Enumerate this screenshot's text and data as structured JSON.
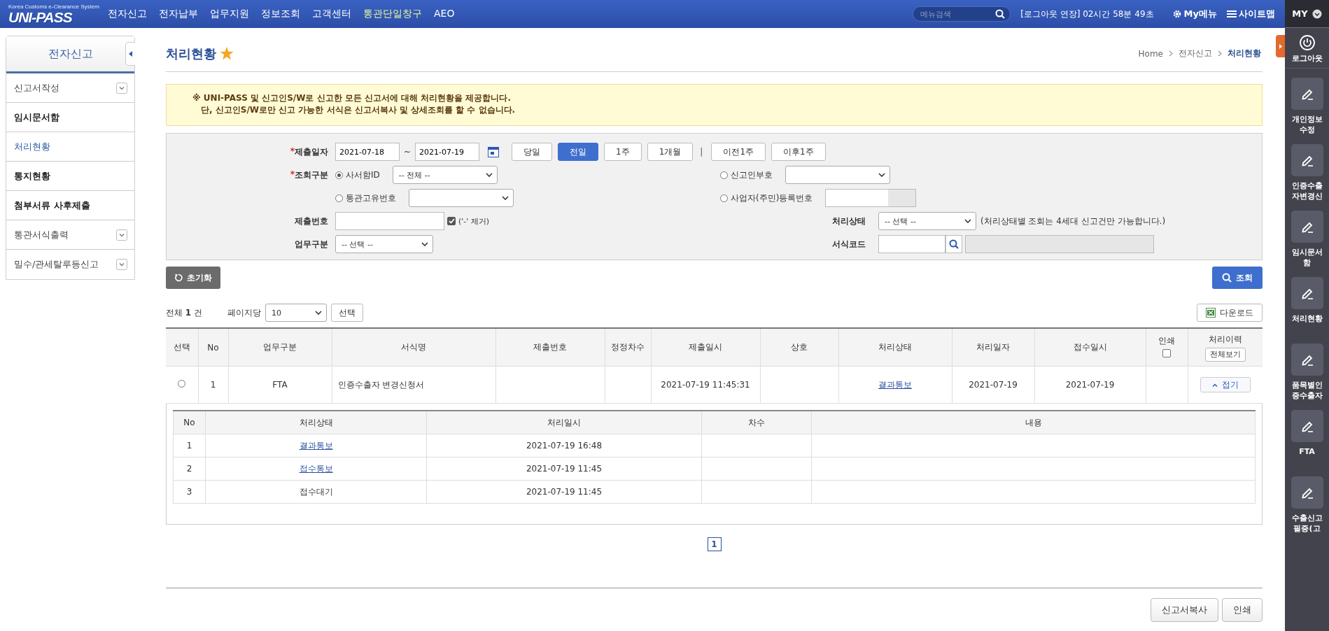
{
  "top_nav": {
    "logo": "UNI-PASS",
    "logo_tagline": "Korea Customs e-Clearance System",
    "menu": [
      {
        "label": "전자신고",
        "highlight": false
      },
      {
        "label": "전자납부",
        "highlight": false
      },
      {
        "label": "업무지원",
        "highlight": false
      },
      {
        "label": "정보조회",
        "highlight": false
      },
      {
        "label": "고객센터",
        "highlight": false
      },
      {
        "label": "통관단일창구",
        "highlight": true
      },
      {
        "label": "AEO",
        "highlight": false
      }
    ],
    "search": {
      "placeholder": "메뉴검색"
    },
    "session": "[로그아웃 연장] 02시간 58분 49초",
    "my_menu": "My메뉴",
    "sitemap": "사이트맵",
    "my": "MY"
  },
  "sidebar": {
    "title": "전자신고",
    "items": [
      {
        "label": "신고서작성",
        "kind": "folder",
        "expanded": false,
        "selected": false
      },
      {
        "label": "임시문서함",
        "kind": "link",
        "selected": false
      },
      {
        "label": "처리현황",
        "kind": "link",
        "selected": true
      },
      {
        "label": "통지현황",
        "kind": "link",
        "selected": false
      },
      {
        "label": "첨부서류 사후제출",
        "kind": "link",
        "selected": false
      },
      {
        "label": "통관서식출력",
        "kind": "folder",
        "expanded": false,
        "selected": false
      },
      {
        "label": "밀수/관세탈루등신고",
        "kind": "folder",
        "expanded": false,
        "selected": false
      }
    ]
  },
  "page": {
    "title": "처리현황",
    "favorite": true,
    "breadcrumb": [
      {
        "label": "Home",
        "current": false
      },
      {
        "label": "전자신고",
        "current": false
      },
      {
        "label": "처리현황",
        "current": true
      }
    ]
  },
  "notice": {
    "lines": [
      "※ UNI-PASS 및 신고인S/W로 신고한 모든 신고서에 대해 처리현황을 제공합니다.",
      "단, 신고인S/W로만 신고 가능한 서식은 신고서복사 및 상세조회를 할 수 없습니다."
    ]
  },
  "search_form": {
    "required_mark": "*",
    "submit_date": {
      "label": "제출일자",
      "required": true,
      "from": "2021-07-18",
      "separator": "~",
      "to": "2021-07-19"
    },
    "period_buttons": [
      {
        "label": "당일",
        "selected": false
      },
      {
        "label": "전일",
        "selected": true
      },
      {
        "label": "1주",
        "selected": false
      },
      {
        "label": "1개월",
        "selected": false
      }
    ],
    "group_divider": "|",
    "week_buttons": [
      {
        "label": "이전1주",
        "selected": false
      },
      {
        "label": "이후1주",
        "selected": false
      }
    ],
    "query_type": {
      "label": "조회구분",
      "required": true,
      "options": [
        {
          "label": "사서함ID",
          "selected": true,
          "kind": "select",
          "value": "-- 전체 --"
        },
        {
          "label": "신고인부호",
          "selected": false,
          "kind": "select"
        },
        {
          "label": "통관고유번호",
          "selected": false,
          "kind": "select"
        },
        {
          "label": "사업자(주민)등록번호",
          "selected": false,
          "kind": "input"
        }
      ]
    },
    "submit_number": {
      "label": "제출번호",
      "strip_dash": {
        "label": "('-' 제거)",
        "checked": true
      }
    },
    "status": {
      "label": "처리상태",
      "value": "-- 선택 --",
      "note": "(처리상태별 조회는 4세대 신고건만 가능합니다.)"
    },
    "business_type": {
      "label": "업무구분",
      "value": "-- 선택 --"
    },
    "form_code": {
      "label": "서식코드"
    },
    "reset_button": "초기화",
    "search_button": "조회"
  },
  "results": {
    "total_label": "전체",
    "total": "1",
    "unit": "건",
    "per_page_label": "페이지당",
    "per_page": "10",
    "apply_button": "선택",
    "download_button": "다운로드",
    "columns": [
      "선택",
      "No",
      "업무구분",
      "서식명",
      "제출번호",
      "정정차수",
      "제출일시",
      "상호",
      "처리상태",
      "처리일자",
      "접수일시",
      "인쇄",
      "처리이력"
    ],
    "print_all_checked": false,
    "history_all_button": "전체보기",
    "rows": [
      {
        "selected": false,
        "no": "1",
        "business": "FTA",
        "form_name": "인증수출자 변경신청서",
        "submitted_at": "2021-07-19 11:45:31",
        "status": "결과통보",
        "processed_date": "2021-07-19",
        "received_date": "2021-07-19",
        "toggle": "접기",
        "expanded": true,
        "history": {
          "columns": [
            "No",
            "처리상태",
            "처리일시",
            "차수",
            "내용"
          ],
          "rows": [
            {
              "no": "1",
              "status": "결과통보",
              "kind": "link",
              "time": "2021-07-19 16:48"
            },
            {
              "no": "2",
              "status": "접수통보",
              "kind": "link",
              "time": "2021-07-19 11:45"
            },
            {
              "no": "3",
              "status": "접수대기",
              "kind": "text",
              "time": "2021-07-19 11:45"
            }
          ]
        }
      }
    ]
  },
  "pagination": [
    {
      "label": "1",
      "selected": true
    }
  ],
  "footer_buttons": [
    "신고서복사",
    "인쇄"
  ],
  "right_panel": {
    "logout": "로그아웃",
    "shortcuts": [
      "개인정보수정",
      "인증수출자변경신",
      "임시문서함",
      "처리현황",
      "품목별인증수출자",
      "FTA",
      "수출신고필증(고"
    ]
  }
}
